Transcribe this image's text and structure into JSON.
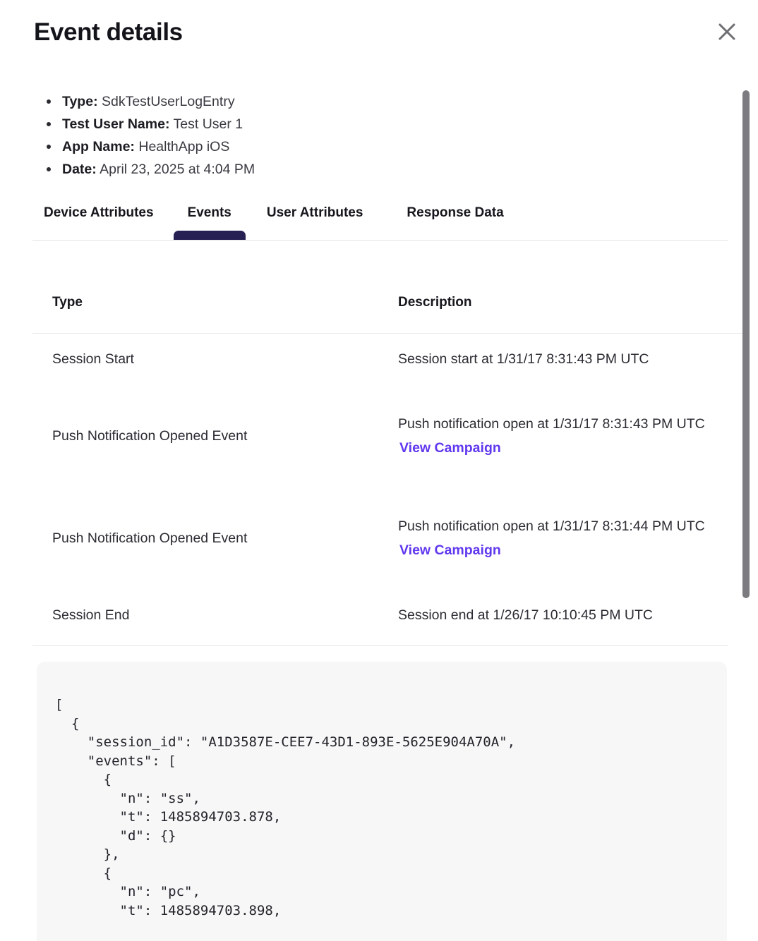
{
  "modal": {
    "title": "Event details",
    "close_icon": "close-icon"
  },
  "meta": [
    {
      "label": "Type:",
      "value": "SdkTestUserLogEntry"
    },
    {
      "label": "Test User Name:",
      "value": "Test User 1"
    },
    {
      "label": "App Name:",
      "value": "HealthApp iOS"
    },
    {
      "label": "Date:",
      "value": "April 23, 2025 at 4:04 PM"
    }
  ],
  "tabs": [
    {
      "label": "Device Attributes",
      "active": false
    },
    {
      "label": "Events",
      "active": true
    },
    {
      "label": "User Attributes",
      "active": false
    },
    {
      "label": "Response Data",
      "active": false
    }
  ],
  "table": {
    "headers": {
      "type": "Type",
      "description": "Description"
    },
    "rows": [
      {
        "type": "Session Start",
        "description": "Session start at 1/31/17 8:31:43 PM UTC",
        "link": ""
      },
      {
        "type": "Push Notification Opened Event",
        "description": "Push notification open at 1/31/17 8:31:43 PM UTC",
        "link": "View Campaign"
      },
      {
        "type": "Push Notification Opened Event",
        "description": "Push notification open at 1/31/17 8:31:44 PM UTC",
        "link": "View Campaign"
      },
      {
        "type": "Session End",
        "description": "Session end at 1/26/17 10:10:45 PM UTC",
        "link": ""
      }
    ]
  },
  "code": {
    "content": "[\n  {\n    \"session_id\": \"A1D3587E-CEE7-43D1-893E-5625E904A70A\",\n    \"events\": [\n      {\n        \"n\": \"ss\",\n        \"t\": 1485894703.878,\n        \"d\": {}\n      },\n      {\n        \"n\": \"pc\",\n        \"t\": 1485894703.898,"
  },
  "colors": {
    "accent_link": "#6138ee",
    "tab_indicator": "#272153",
    "code_bg": "#f7f7f8",
    "scrollbar_thumb": "#7c7c80"
  }
}
